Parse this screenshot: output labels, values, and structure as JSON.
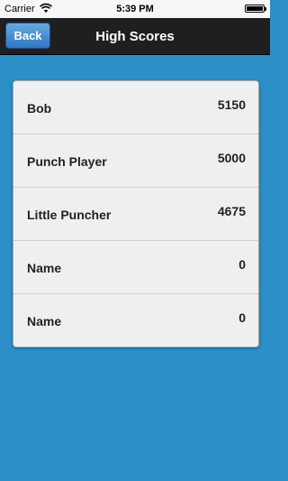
{
  "status_bar": {
    "carrier": "Carrier",
    "time": "5:39 PM",
    "wifi_icon": "wifi-icon",
    "battery_icon": "battery-icon"
  },
  "nav": {
    "back_label": "Back",
    "title": "High Scores"
  },
  "scores": [
    {
      "name": "Bob",
      "score": "5150"
    },
    {
      "name": "Punch Player",
      "score": "5000"
    },
    {
      "name": "Little Puncher",
      "score": "4675"
    },
    {
      "name": "Name",
      "score": "0"
    },
    {
      "name": "Name",
      "score": "0"
    }
  ],
  "colors": {
    "background": "#2c8fc8",
    "nav_bar": "#1f1f1f",
    "back_button": "#3f86cf",
    "card": "#efefef"
  }
}
